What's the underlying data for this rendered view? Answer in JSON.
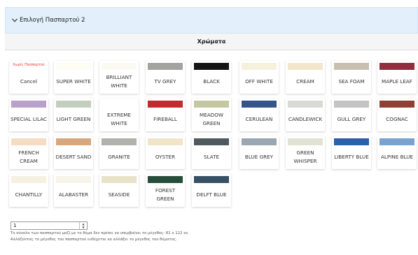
{
  "accordion": {
    "title": "Επιλογή Πασπαρτού 2",
    "icon": "chevron-down-icon"
  },
  "section": {
    "header": "Χρώματα"
  },
  "cancel_tile": {
    "caption": "Χωρίς Πασπαρτού",
    "label": "Cancel"
  },
  "colors": [
    {
      "label": "SUPER WHITE",
      "color": "#fdfdf3"
    },
    {
      "label": "BRILLIANT WHITE",
      "color": "#fbfaf2"
    },
    {
      "label": "TV GREY",
      "color": "#a3a3a1"
    },
    {
      "label": "BLACK",
      "color": "#151515"
    },
    {
      "label": "OFF WHITE",
      "color": "#f6f1dc"
    },
    {
      "label": "CREAM",
      "color": "#f3e6cb"
    },
    {
      "label": "SEA FOAM",
      "color": "#c9bfb0"
    },
    {
      "label": "MAPLE LEAF",
      "color": "#8f2e3c"
    },
    {
      "label": "SPECIAL LILAC",
      "color": "#b9a1cc"
    },
    {
      "label": "LIGHT GREEN",
      "color": "#c2cfbe"
    },
    {
      "label": "EXTREME WHITE",
      "color": "#ffffff"
    },
    {
      "label": "FIREBALL",
      "color": "#c42b2f"
    },
    {
      "label": "MEADOW GREEN",
      "color": "#c3c8a3"
    },
    {
      "label": "CERULEAN",
      "color": "#35548a"
    },
    {
      "label": "CANDLEWICK",
      "color": "#d9d9d5"
    },
    {
      "label": "GULL GREY",
      "color": "#c3c3c3"
    },
    {
      "label": "COGNAC",
      "color": "#8f4034"
    },
    {
      "label": "FRENCH CREAM",
      "color": "#f4ddc2"
    },
    {
      "label": "DESERT SAND",
      "color": "#d7a77d"
    },
    {
      "label": "GRANITE",
      "color": "#b2b2ad"
    },
    {
      "label": "OYSTER",
      "color": "#f1e5c8"
    },
    {
      "label": "SLATE",
      "color": "#4e5a5d"
    },
    {
      "label": "BLUE GREY",
      "color": "#9aa7b2"
    },
    {
      "label": "GREEN WHISPER",
      "color": "#dfe3d3"
    },
    {
      "label": "LIBERTY BLUE",
      "color": "#2960a9"
    },
    {
      "label": "ALPINE BLUE",
      "color": "#7aa2cf"
    },
    {
      "label": "CHANTILLY",
      "color": "#f5f0e0"
    },
    {
      "label": "ALABASTER",
      "color": "#f7f4ea"
    },
    {
      "label": "SEASIDE",
      "color": "#e8e2c9"
    },
    {
      "label": "FOREST GREEN",
      "color": "#264d3a"
    },
    {
      "label": "DELFT BLUE",
      "color": "#375064"
    }
  ],
  "quantity": {
    "value": "1"
  },
  "notes": [
    "Το σύνολο των πασπαρτού μαζί με το θέμα δεν πρέπει να υπερβαίνει το μέγεθος: 81 x 122 εκ.",
    "Αλλάζοντας το μέγεθος του πασπαρτού ενδέχεται να αλλάξει το μέγεθος του θέματος."
  ]
}
